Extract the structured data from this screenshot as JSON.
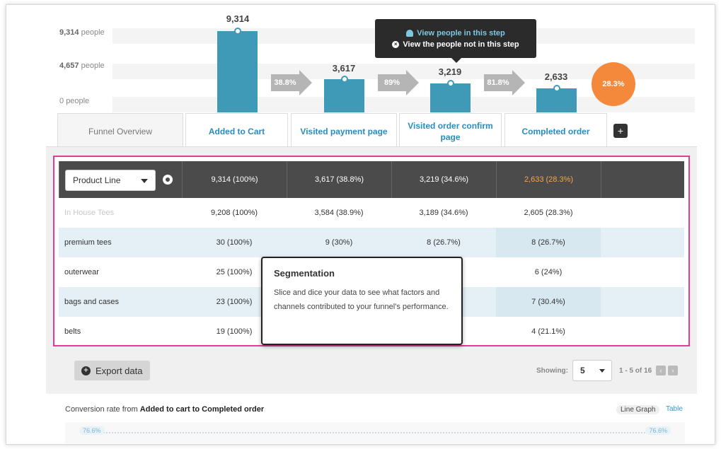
{
  "chart": {
    "y_labels": [
      {
        "value": "9,314",
        "unit": "people"
      },
      {
        "value": "4,657",
        "unit": "people"
      },
      {
        "value": "0",
        "unit": "people"
      }
    ],
    "steps": [
      {
        "value": "9,314"
      },
      {
        "value": "3,617"
      },
      {
        "value": "3,219"
      },
      {
        "value": "2,633"
      }
    ],
    "arrows": [
      "38.8%",
      "89%",
      "81.8%"
    ],
    "overall": "28.3%",
    "tooltip": {
      "view_in": "View people in this step",
      "view_not_in": "View the people not in this step"
    }
  },
  "tabs": {
    "overview": "Funnel Overview",
    "steps": [
      "Added to Cart",
      "Visited payment page",
      "Visited order confirm page",
      "Completed order"
    ],
    "add": "+"
  },
  "table": {
    "segment_select": "Product Line",
    "header": [
      "9,314 (100%)",
      "3,617 (38.8%)",
      "3,219 (34.6%)",
      "2,633 (28.3%)"
    ],
    "rows": [
      {
        "name": "In House Tees",
        "cells": [
          "9,208 (100%)",
          "3,584 (38.9%)",
          "3,189 (34.6%)",
          "2,605 (28.3%)"
        ]
      },
      {
        "name": "premium tees",
        "cells": [
          "30 (100%)",
          "9 (30%)",
          "8 (26.7%)",
          "8 (26.7%)"
        ]
      },
      {
        "name": "outerwear",
        "cells": [
          "25 (100%)",
          "",
          "",
          "6 (24%)"
        ]
      },
      {
        "name": "bags and cases",
        "cells": [
          "23 (100%)",
          "",
          "",
          "7 (30.4%)"
        ]
      },
      {
        "name": "belts",
        "cells": [
          "19 (100%)",
          "",
          "",
          "4 (21.1%)"
        ]
      }
    ]
  },
  "segmentation_tip": {
    "title": "Segmentation",
    "body": "Slice and dice your data to see what factors and channels contributed to your funnel's performance."
  },
  "footer": {
    "export": "Export data",
    "showing_label": "Showing:",
    "page_size": "5",
    "page_info": "1 - 5 of 16"
  },
  "conversion": {
    "title_prefix": "Conversion rate from",
    "title_strong": "Added to cart to Completed order",
    "toggle_graph": "Line Graph",
    "toggle_table": "Table",
    "left_value": "76.6%",
    "right_value": "76.6%"
  },
  "colors": {
    "bar": "#3e9ab7",
    "accent_orange": "#f5893b",
    "highlight_border": "#e23c93",
    "link": "#2a8bbf"
  }
}
